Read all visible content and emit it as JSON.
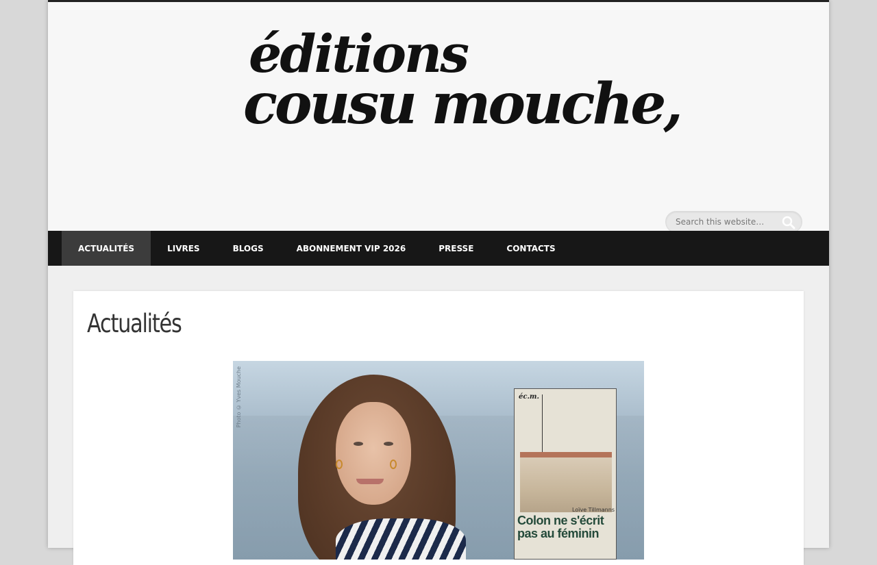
{
  "header": {
    "logo_line1": "éditions",
    "logo_line2": "cousu mouche,",
    "search_placeholder": "Search this website…"
  },
  "nav": {
    "items": [
      {
        "label": "ACTUALITÉS",
        "active": true
      },
      {
        "label": "LIVRES",
        "active": false
      },
      {
        "label": "BLOGS",
        "active": false
      },
      {
        "label": "ABONNEMENT VIP 2026",
        "active": false
      },
      {
        "label": "PRESSE",
        "active": false
      },
      {
        "label": "CONTACTS",
        "active": false
      }
    ]
  },
  "main": {
    "title": "Actualités",
    "feature": {
      "photo_credit": "Photo © Yves Mouche",
      "book_logo": "éc.m.",
      "book_author": "Loïve Tillmanns",
      "book_title": "Colon ne s'écrit pas au féminin"
    }
  },
  "colors": {
    "nav_bg": "#171717",
    "nav_active_bg": "#3c3c3c",
    "page_bg": "#d8d8d8",
    "book_title": "#244a3a"
  }
}
